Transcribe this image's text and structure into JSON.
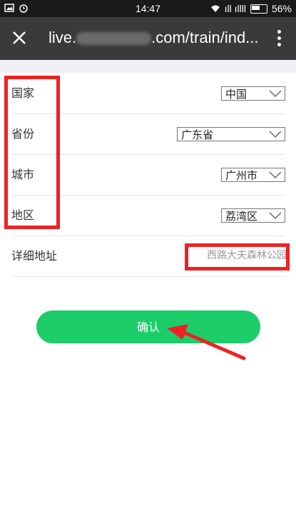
{
  "status_bar": {
    "time": "14:47",
    "battery": "56%",
    "signal": "ıll ıllll"
  },
  "nav": {
    "url_prefix": "live.",
    "url_suffix": ".com/train/ind..."
  },
  "form": {
    "country": {
      "label": "国家",
      "value": "中国"
    },
    "province": {
      "label": "省份",
      "value": "广东省"
    },
    "city": {
      "label": "城市",
      "value": "广州市"
    },
    "district": {
      "label": "地区",
      "value": "荔湾区"
    },
    "address": {
      "label": "详细地址",
      "value": "西路大夫森林公园"
    }
  },
  "confirm_label": "确认",
  "colors": {
    "accent_green": "#1ccd6a",
    "nav_bg": "#3a3a3c",
    "status_bg": "#1a1a1a",
    "highlight_red": "#ee2222"
  },
  "icons": [
    "image-icon",
    "alarm-icon",
    "wifi-icon",
    "signal-icon",
    "battery-icon",
    "close-icon",
    "more-icon",
    "chevron-down-icon"
  ]
}
